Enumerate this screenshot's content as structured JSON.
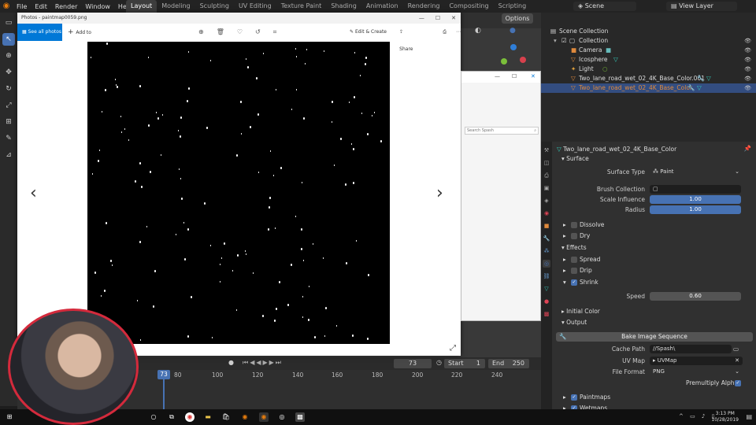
{
  "blender": {
    "menu": [
      "File",
      "Edit",
      "Render",
      "Window",
      "Help"
    ],
    "workspaces": [
      "Layout",
      "Modeling",
      "Sculpting",
      "UV Editing",
      "Texture Paint",
      "Shading",
      "Animation",
      "Rendering",
      "Compositing",
      "Scripting"
    ],
    "active_workspace": "Layout",
    "scene": "Scene",
    "view_layer": "View Layer",
    "options_label": "Options"
  },
  "photos": {
    "title": "Photos - paintmap0059.png",
    "see_all": "See all photos",
    "add_to": "Add to",
    "edit_create": "Edit & Create",
    "share": "Share"
  },
  "explorer": {
    "search_placeholder": "Search Spash"
  },
  "outliner": {
    "root": "Scene Collection",
    "items": [
      {
        "label": "Collection"
      },
      {
        "label": "Camera"
      },
      {
        "label": "Icosphere"
      },
      {
        "label": "Light"
      },
      {
        "label": "Two_lane_road_wet_02_4K_Base_Color.001"
      },
      {
        "label": "Two_lane_road_wet_02_4K_Base_Color"
      }
    ]
  },
  "properties": {
    "object_name": "Two_lane_road_wet_02_4K_Base_Color",
    "surface": "Surface",
    "surface_type_label": "Surface Type",
    "surface_type_value": "Paint",
    "brush_collection_label": "Brush Collection",
    "scale_influence_label": "Scale Influence",
    "scale_influence_value": "1.00",
    "radius_label": "Radius",
    "radius_value": "1.00",
    "dissolve": "Dissolve",
    "dry": "Dry",
    "effects": "Effects",
    "spread": "Spread",
    "drip": "Drip",
    "shrink": "Shrink",
    "speed_label": "Speed",
    "speed_value": "0.60",
    "initial_color": "Initial Color",
    "output": "Output",
    "bake_button": "Bake Image Sequence",
    "cache_path_label": "Cache Path",
    "cache_path_value": "//Spash\\",
    "uv_map_label": "UV Map",
    "uv_map_value": "UVMap",
    "file_format_label": "File Format",
    "file_format_value": "PNG",
    "premultiply": "Premultiply Alpha",
    "paintmaps": "Paintmaps",
    "wetmaps": "Wetmaps"
  },
  "timeline": {
    "current_frame": "73",
    "start_label": "Start",
    "start_value": "1",
    "end_label": "End",
    "end_value": "250",
    "ticks": [
      "80",
      "100",
      "120",
      "140",
      "160",
      "180",
      "200",
      "220",
      "240"
    ]
  },
  "taskbar": {
    "time": "3:13 PM",
    "date": "10/28/2019"
  }
}
